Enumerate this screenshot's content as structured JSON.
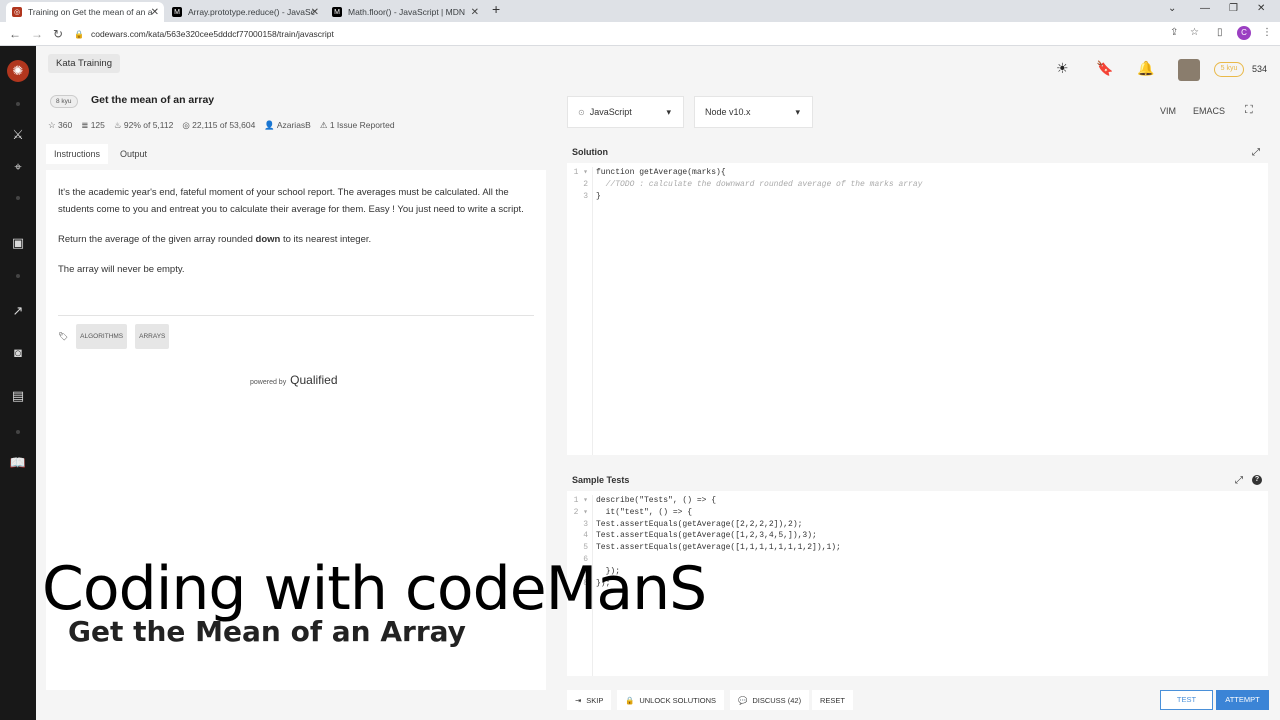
{
  "browser": {
    "tabs": [
      {
        "title": "Training on Get the mean of an a"
      },
      {
        "title": "Array.prototype.reduce() - JavaSc"
      },
      {
        "title": "Math.floor() - JavaScript | MDN"
      }
    ],
    "url": "codewars.com/kata/563e320cee5dddcf77000158/train/javascript"
  },
  "header": {
    "section": "Kata Training",
    "rank": "5 kyu",
    "honor": "534"
  },
  "kata": {
    "kyu": "8 kyu",
    "title": "Get the mean of an array",
    "stats": {
      "stars": "360",
      "votes": "125",
      "satisfaction": "92% of 5,112",
      "completions": "22,115 of 53,604",
      "author": "AzariasB",
      "issues": "1 Issue Reported"
    },
    "tabs": [
      "Instructions",
      "Output"
    ],
    "description": [
      "It's the academic year's end, fateful moment of your school report. The averages must be calculated. All the students come to you and entreat you to calculate their average for them. Easy ! You just need to write a script.",
      "The array will never be empty."
    ],
    "desc2_pre": "Return the average of the given array rounded ",
    "desc2_bold": "down",
    "desc2_post": " to its nearest integer.",
    "tags": [
      "ALGORITHMS",
      "ARRAYS"
    ],
    "powered_by": "powered by",
    "powered_brand": "Qualified"
  },
  "editor": {
    "language": "JavaScript",
    "runtime": "Node v10.x",
    "vim": "VIM",
    "emacs": "EMACS",
    "solution_title": "Solution",
    "solution_lines": [
      "function getAverage(marks){",
      "  //TODO : calculate the downward rounded average of the marks array",
      "}"
    ],
    "tests_title": "Sample Tests",
    "test_lines": [
      "describe(\"Tests\", () => {",
      "  it(\"test\", () => {",
      "Test.assertEquals(getAverage([2,2,2,2]),2);",
      "Test.assertEquals(getAverage([1,2,3,4,5,]),3);",
      "Test.assertEquals(getAverage([1,1,1,1,1,1,1,2]),1);",
      "",
      "  });",
      "});"
    ]
  },
  "actions": {
    "skip": "SKIP",
    "unlock": "UNLOCK SOLUTIONS",
    "discuss": "DISCUSS (42)",
    "reset": "RESET",
    "test": "TEST",
    "attempt": "ATTEMPT"
  },
  "overlay": {
    "title": "Coding with codeManS",
    "subtitle": "Get the Mean of an Array"
  }
}
